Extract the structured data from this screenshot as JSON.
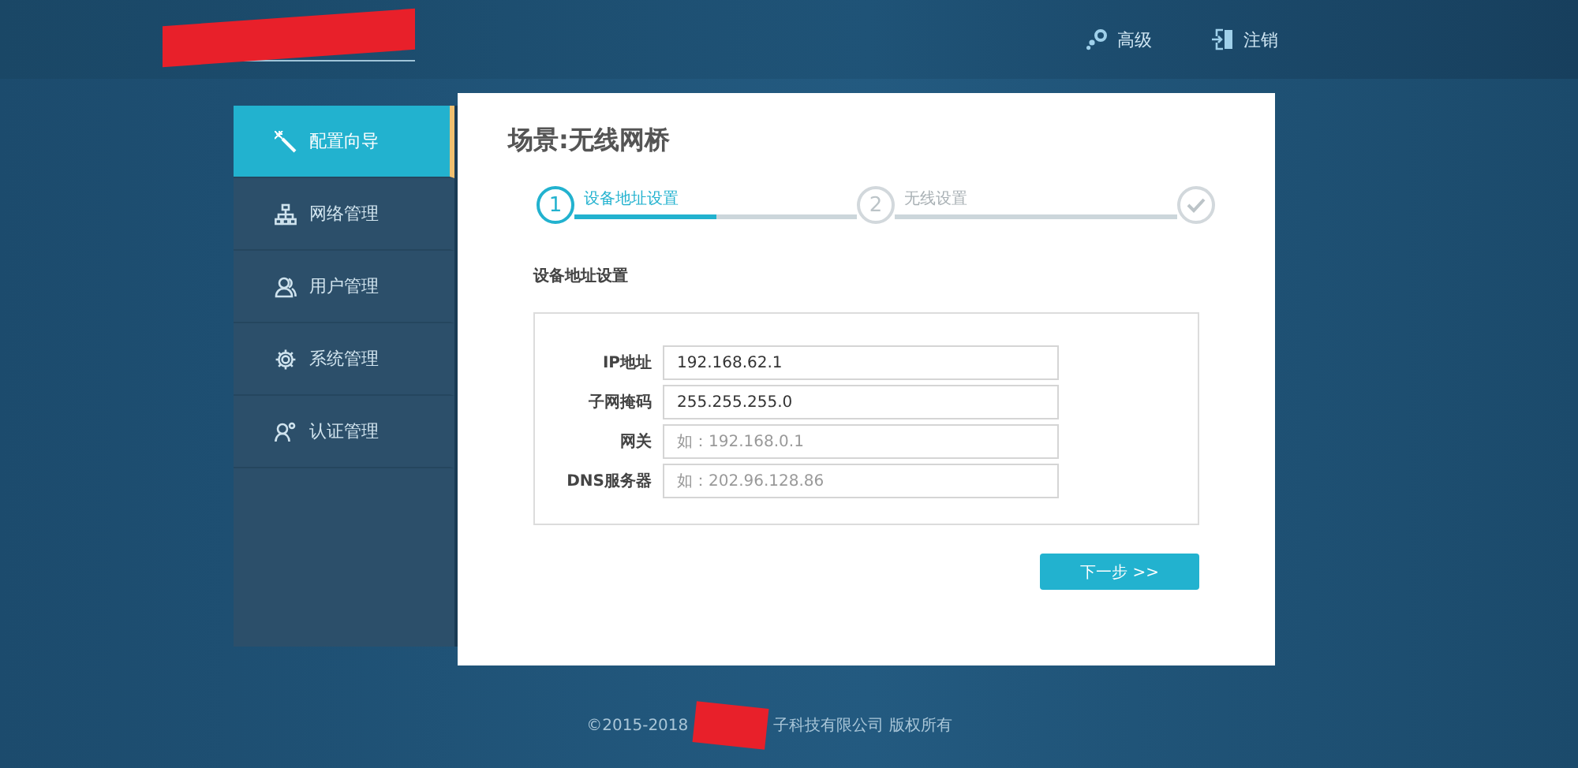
{
  "header": {
    "links": [
      {
        "label": "高级"
      },
      {
        "label": "注销"
      }
    ]
  },
  "sidebar": {
    "items": [
      {
        "label": "配置向导",
        "selected": true
      },
      {
        "label": "网络管理",
        "selected": false
      },
      {
        "label": "用户管理",
        "selected": false
      },
      {
        "label": "系统管理",
        "selected": false
      },
      {
        "label": "认证管理",
        "selected": false
      }
    ]
  },
  "panel": {
    "title": "场景:无线网桥",
    "steps": [
      {
        "kind": "number",
        "number": "1",
        "label": "设备地址设置",
        "selected": true,
        "level": 0.5
      },
      {
        "kind": "number",
        "number": "2",
        "label": "无线设置",
        "selected": false
      },
      {
        "kind": "done"
      }
    ],
    "section_title": "设备地址设置",
    "fields": [
      {
        "label": "IP地址",
        "value": "192.168.62.1"
      },
      {
        "label": "子网掩码",
        "value": "255.255.255.0"
      },
      {
        "label": "网关",
        "placeholder": "如：192.168.0.1"
      },
      {
        "label": "DNS服务器",
        "placeholder": "如：202.96.128.86"
      }
    ],
    "next_button": "下一步 >>"
  },
  "footer": {
    "left": "©2015-2018",
    "right": "子科技有限公司 版权所有"
  }
}
